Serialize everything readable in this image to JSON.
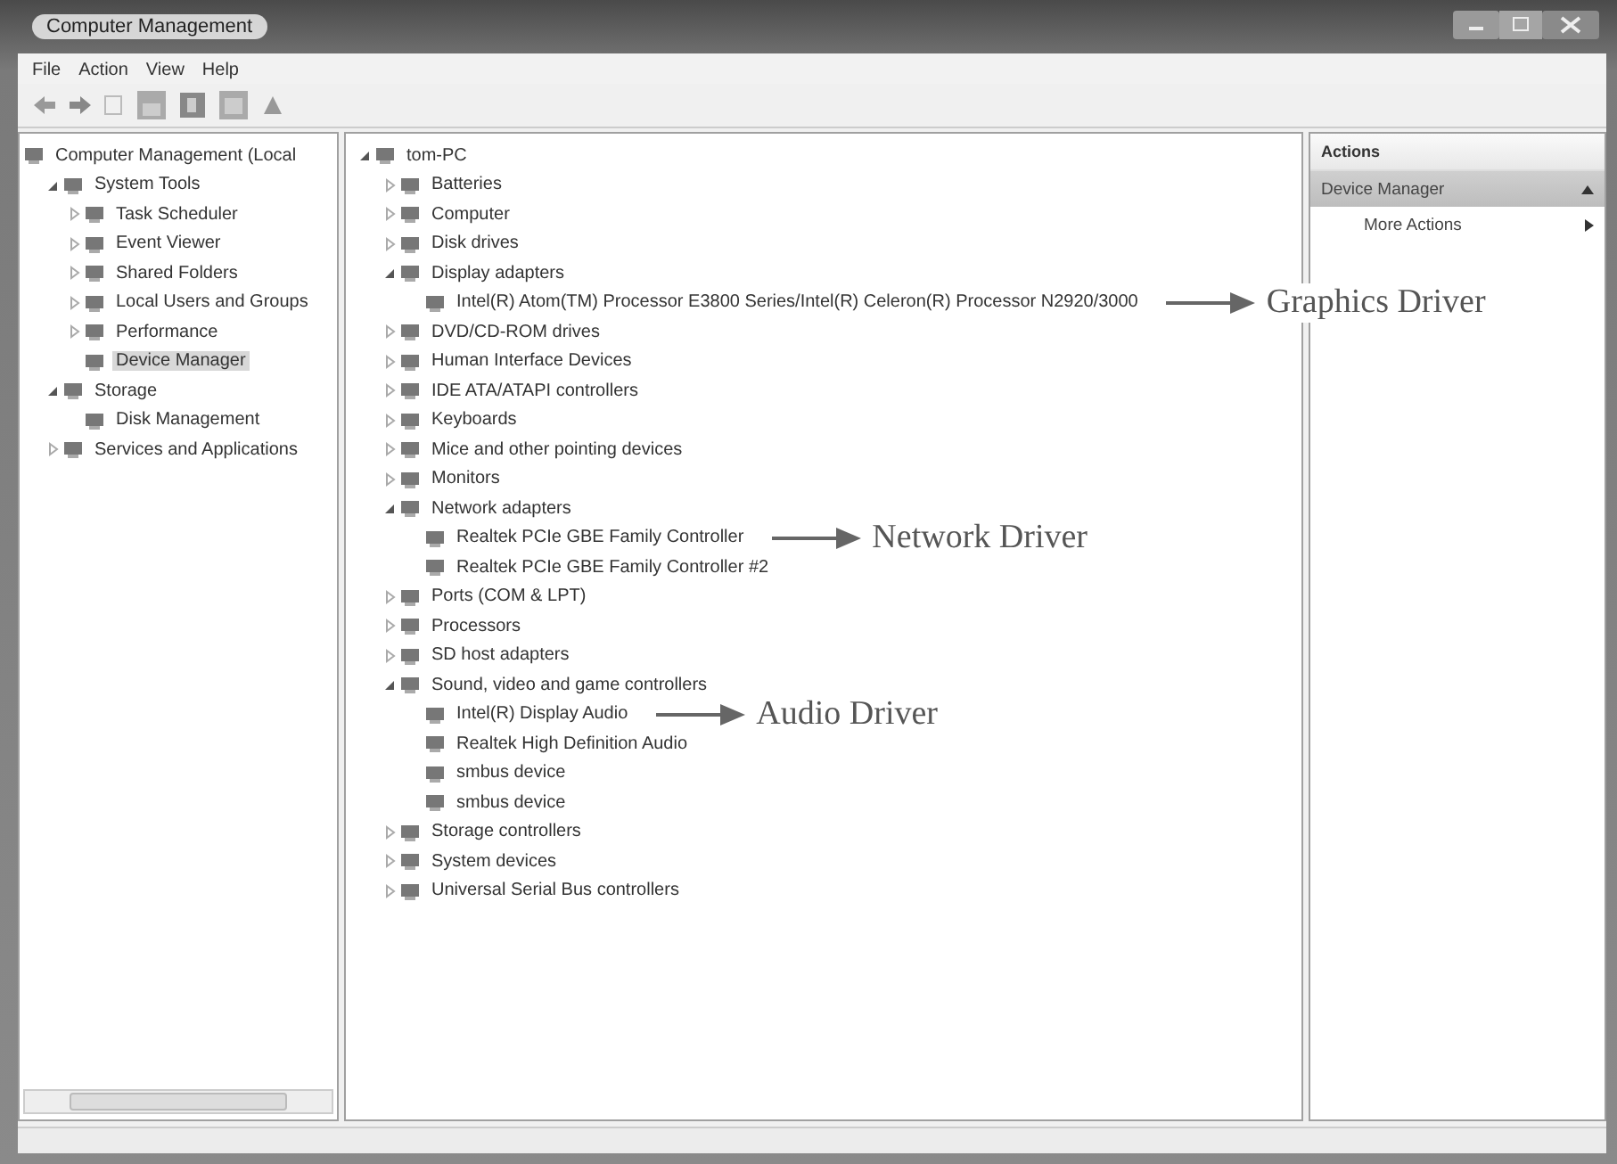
{
  "window": {
    "title": "Computer Management"
  },
  "menu": [
    "File",
    "Action",
    "View",
    "Help"
  ],
  "console_tree": [
    {
      "label": "Computer Management (Local",
      "children": [
        {
          "label": "System Tools",
          "expanded": true,
          "selected": false,
          "children": [
            {
              "label": "Task Scheduler",
              "expanded": false,
              "selected": false
            },
            {
              "label": "Event Viewer",
              "expanded": false,
              "selected": false
            },
            {
              "label": "Shared Folders",
              "expanded": false,
              "selected": false
            },
            {
              "label": "Local Users and Groups",
              "expanded": false,
              "selected": false
            },
            {
              "label": "Performance",
              "expanded": false,
              "selected": false
            },
            {
              "label": "Device Manager",
              "selected": true
            }
          ]
        },
        {
          "label": "Storage",
          "expanded": true,
          "selected": false,
          "children": [
            {
              "label": "Disk Management",
              "selected": false
            }
          ]
        },
        {
          "label": "Services and Applications",
          "expanded": false,
          "selected": false
        }
      ]
    }
  ],
  "device_tree": {
    "label": "tom-PC",
    "expanded": true,
    "children": [
      {
        "label": "Batteries",
        "expanded": false
      },
      {
        "label": "Computer",
        "expanded": false
      },
      {
        "label": "Disk drives",
        "expanded": false
      },
      {
        "label": "Display adapters",
        "expanded": true,
        "children": [
          {
            "label": "Intel(R) Atom(TM) Processor E3800 Series/Intel(R) Celeron(R) Processor N2920/3000",
            "annotation": "Graphics Driver"
          }
        ]
      },
      {
        "label": "DVD/CD-ROM drives",
        "expanded": false
      },
      {
        "label": "Human Interface Devices",
        "expanded": false
      },
      {
        "label": "IDE ATA/ATAPI controllers",
        "expanded": false
      },
      {
        "label": "Keyboards",
        "expanded": false
      },
      {
        "label": "Mice and other pointing devices",
        "expanded": false
      },
      {
        "label": "Monitors",
        "expanded": false
      },
      {
        "label": "Network adapters",
        "expanded": true,
        "children": [
          {
            "label": "Realtek PCIe GBE Family Controller",
            "annotation": "Network Driver"
          },
          {
            "label": "Realtek PCIe GBE Family Controller #2"
          }
        ]
      },
      {
        "label": "Ports (COM & LPT)",
        "expanded": false
      },
      {
        "label": "Processors",
        "expanded": false
      },
      {
        "label": "SD host adapters",
        "expanded": false
      },
      {
        "label": "Sound, video and game controllers",
        "expanded": true,
        "children": [
          {
            "label": "Intel(R) Display Audio",
            "annotation": "Audio Driver"
          },
          {
            "label": "Realtek High Definition Audio"
          },
          {
            "label": "smbus device"
          },
          {
            "label": "smbus device"
          }
        ]
      },
      {
        "label": "Storage controllers",
        "expanded": false
      },
      {
        "label": "System devices",
        "expanded": false
      },
      {
        "label": "Universal Serial Bus controllers",
        "expanded": false
      }
    ]
  },
  "actions": {
    "title": "Actions",
    "items": [
      {
        "label": "Device Manager",
        "kind": "header"
      },
      {
        "label": "More Actions",
        "kind": "submenu"
      }
    ]
  }
}
